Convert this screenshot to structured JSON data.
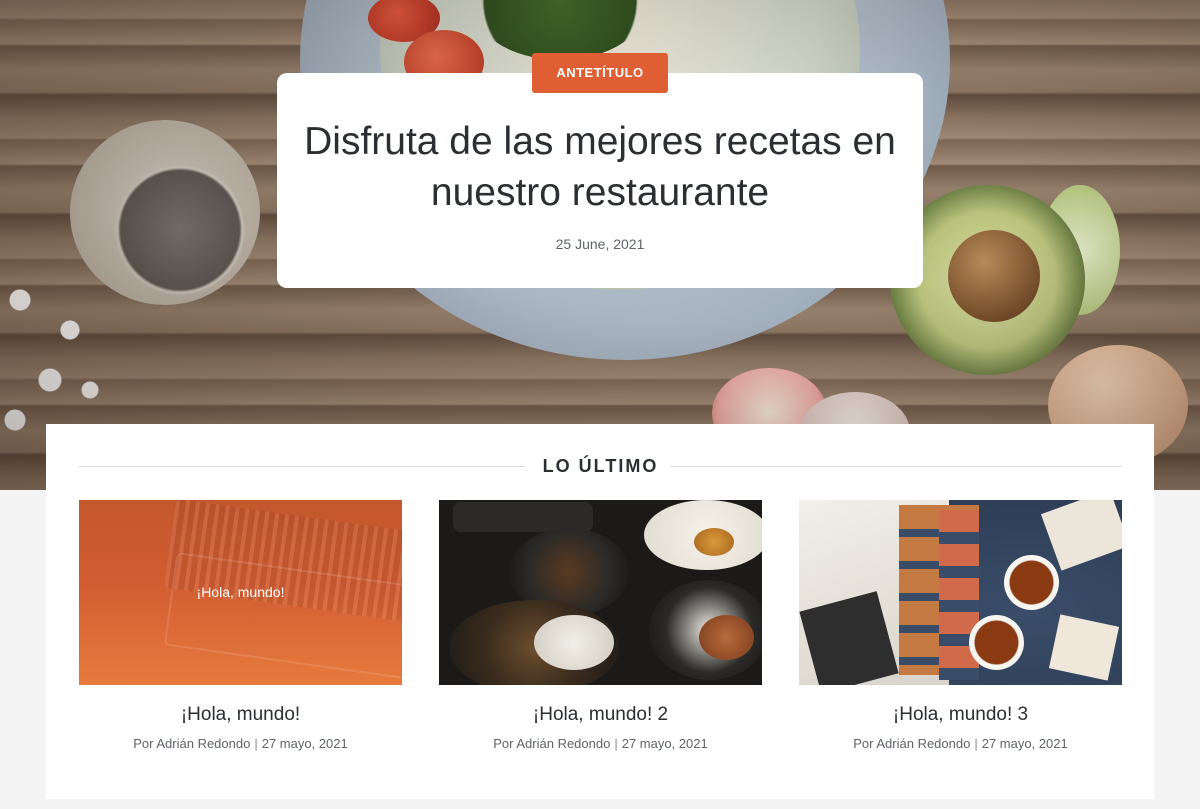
{
  "hero": {
    "kicker": "ANTETÍTULO",
    "title": "Disfruta de las mejores recetas en nuestro restaurante",
    "date": "25 June, 2021"
  },
  "latest": {
    "heading": "LO ÚLTIMO",
    "posts": [
      {
        "thumb_label": "¡Hola, mundo!",
        "title": "¡Hola, mundo!",
        "author": "Por Adrián Redondo",
        "date": "27 mayo, 2021"
      },
      {
        "title": "¡Hola, mundo! 2",
        "author": "Por Adrián Redondo",
        "date": "27 mayo, 2021"
      },
      {
        "title": "¡Hola, mundo! 3",
        "author": "Por Adrián Redondo",
        "date": "27 mayo, 2021"
      }
    ]
  },
  "colors": {
    "accent": "#e05e33",
    "text": "#2b2f33",
    "muted": "#5f6368"
  }
}
